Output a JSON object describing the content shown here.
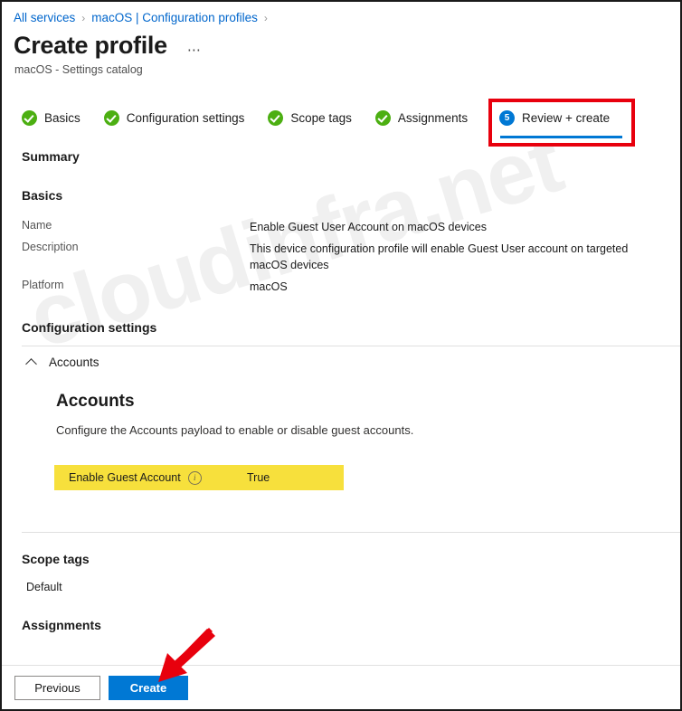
{
  "breadcrumb": {
    "items": [
      {
        "label": "All services"
      },
      {
        "label": "macOS | Configuration profiles"
      }
    ],
    "separator": "›"
  },
  "header": {
    "title": "Create profile",
    "subtitle": "macOS - Settings catalog",
    "overflow_label": "⋯"
  },
  "wizard": {
    "steps": [
      {
        "label": "Basics",
        "state": "complete",
        "icon": "check-circle-icon"
      },
      {
        "label": "Configuration settings",
        "state": "complete",
        "icon": "check-circle-icon"
      },
      {
        "label": "Scope tags",
        "state": "complete",
        "icon": "check-circle-icon"
      },
      {
        "label": "Assignments",
        "state": "complete",
        "icon": "check-circle-icon"
      }
    ],
    "active_step": {
      "number": "5",
      "label": "Review + create",
      "state": "active"
    }
  },
  "summary": {
    "heading": "Summary",
    "basics": {
      "heading": "Basics",
      "rows": [
        {
          "label": "Name",
          "value": "Enable Guest User Account on macOS devices"
        },
        {
          "label": "Description",
          "value": "This device configuration profile will enable Guest User account on targeted macOS devices"
        },
        {
          "label": "Platform",
          "value": "macOS"
        }
      ]
    },
    "configuration_settings": {
      "heading": "Configuration settings",
      "accordion": {
        "label": "Accounts",
        "expanded": true,
        "icon": "chevron-up-icon"
      },
      "payload": {
        "title": "Accounts",
        "description": "Configure the Accounts payload to enable or disable guest accounts.",
        "settings": [
          {
            "name": "Enable Guest Account",
            "info_icon": "info-icon",
            "value": "True",
            "highlighted": true
          }
        ]
      }
    },
    "scope_tags": {
      "heading": "Scope tags",
      "values": [
        "Default"
      ]
    },
    "assignments": {
      "heading": "Assignments",
      "values": []
    }
  },
  "footer": {
    "previous_label": "Previous",
    "create_label": "Create"
  },
  "annotations": {
    "highlight_box_color": "#e8000d",
    "arrow_color": "#e8000d",
    "arrow_name": "red-arrow-pointing-to-create-button"
  },
  "watermark": {
    "text": "cloudinfra.net"
  },
  "colors": {
    "accent": "#0078d4",
    "link": "#0066cc",
    "success": "#4caf12",
    "highlight": "#f7e03c",
    "annotation": "#e8000d"
  }
}
